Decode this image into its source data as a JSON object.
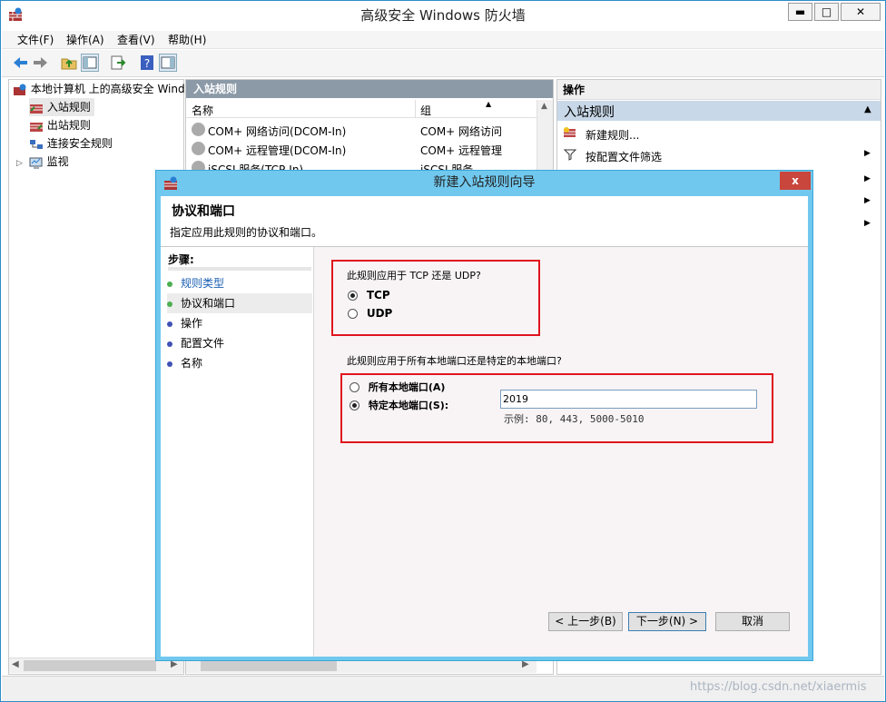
{
  "window": {
    "title": "高级安全 Windows 防火墙",
    "min_label": "▬",
    "max_label": "□",
    "close_label": "✕"
  },
  "menu": [
    "文件(F)",
    "操作(A)",
    "查看(V)",
    "帮助(H)"
  ],
  "tree": {
    "root": "本地计算机 上的高级安全 Wind",
    "items": [
      "入站规则",
      "出站规则",
      "连接安全规则",
      "监视"
    ]
  },
  "center": {
    "header": "入站规则",
    "col_name": "名称",
    "col_group": "组",
    "rows": [
      {
        "name": "COM+ 网络访问(DCOM-In)",
        "group": "COM+ 网络访问"
      },
      {
        "name": "COM+ 远程管理(DCOM-In)",
        "group": "COM+ 远程管理"
      },
      {
        "name": "iSCSI 服务(TCP-In)",
        "group": "iSCSI 服务"
      }
    ]
  },
  "actions": {
    "header": "操作",
    "section": "入站规则",
    "items": [
      "新建规则...",
      "按配置文件筛选"
    ]
  },
  "dialog": {
    "title": "新建入站规则向导",
    "close_label": "x",
    "heading": "协议和端口",
    "subheading": "指定应用此规则的协议和端口。",
    "steps_title": "步骤:",
    "steps": [
      {
        "label": "规则类型",
        "color": "#4caf50",
        "link": true
      },
      {
        "label": "协议和端口",
        "color": "#4caf50",
        "link": false
      },
      {
        "label": "操作",
        "color": "#3f51b5",
        "link": false
      },
      {
        "label": "配置文件",
        "color": "#3f51b5",
        "link": false
      },
      {
        "label": "名称",
        "color": "#3f51b5",
        "link": false
      }
    ],
    "protocol_question": "此规则应用于 TCP 还是 UDP?",
    "protocol_options": [
      {
        "label": "TCP",
        "selected": true
      },
      {
        "label": "UDP",
        "selected": false
      }
    ],
    "port_question": "此规则应用于所有本地端口还是特定的本地端口?",
    "port_options": [
      {
        "label": "所有本地端口(A)",
        "selected": false
      },
      {
        "label": "特定本地端口(S):",
        "selected": true
      }
    ],
    "port_value": "2019",
    "port_example": "示例: 80, 443, 5000-5010",
    "back_button": "< 上一步(B)",
    "next_button": "下一步(N) >",
    "cancel_button": "取消"
  },
  "watermark": "https://blog.csdn.net/xiaermis",
  "colors": {
    "dialog_border": "#70c8ee",
    "highlight_red": "#e0141e",
    "pane_header": "#8c9aa8"
  }
}
